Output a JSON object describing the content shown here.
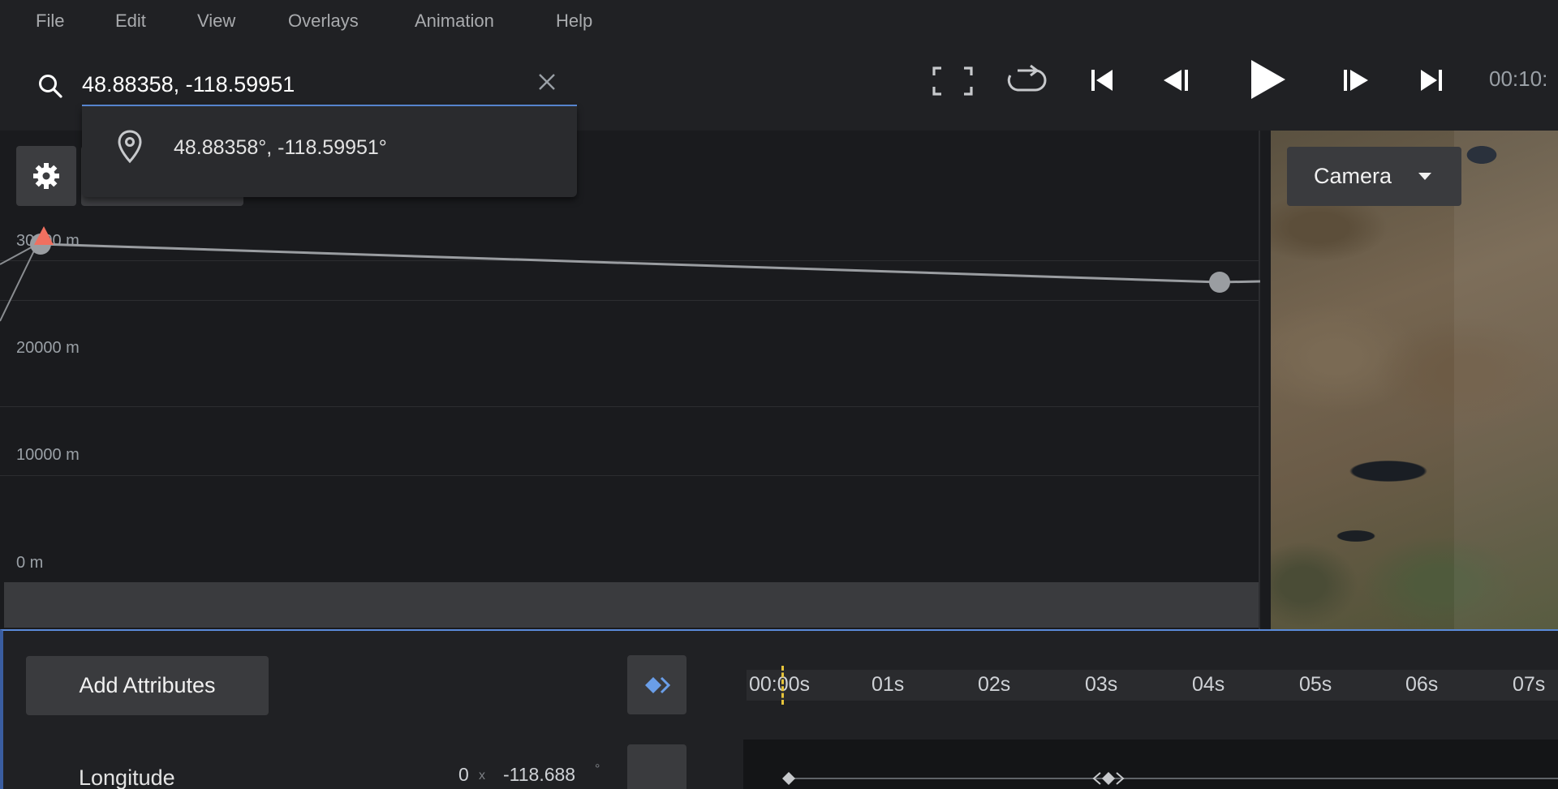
{
  "menu": {
    "items": [
      {
        "label": "File"
      },
      {
        "label": "Edit"
      },
      {
        "label": "View"
      },
      {
        "label": "Overlays"
      },
      {
        "label": "Animation"
      },
      {
        "label": "Help"
      }
    ]
  },
  "search": {
    "value": "48.88358, -118.59951",
    "result": "48.88358°, -118.59951°"
  },
  "transport": {
    "timecode": "00:10:"
  },
  "graph": {
    "ylabels": [
      "30000 m",
      "20000 m",
      "10000 m",
      "0 m"
    ]
  },
  "map": {
    "camera_label": "Camera"
  },
  "timeline": {
    "add_attributes_label": "Add Attributes",
    "ticks": [
      "00:00s",
      "01s",
      "02s",
      "03s",
      "04s",
      "05s",
      "06s",
      "07s"
    ],
    "row": {
      "label": "Longitude",
      "zero": "0",
      "x": "x",
      "value": "-118.688",
      "deg": "°"
    }
  },
  "colors": {
    "accent": "#5b8bd9",
    "keyframe_marker": "#f07060",
    "playhead": "#e5c33b"
  }
}
